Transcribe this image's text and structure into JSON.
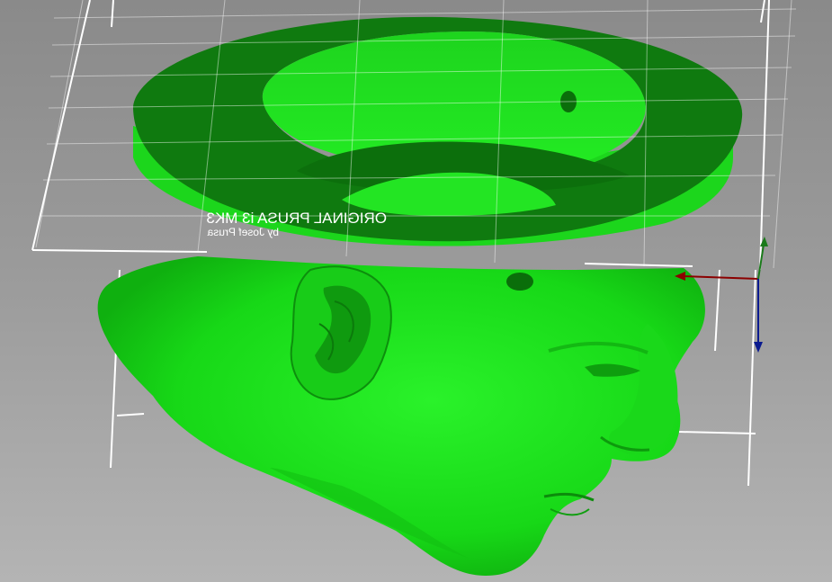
{
  "bed": {
    "brand_line": "ORIGINAL PRUSA i3 MK3",
    "author_line": "by Josef Prusa"
  },
  "model": {
    "color": "#1fe01f",
    "cut_color": "#0f7a0f"
  },
  "axes": {
    "x_color": "#8b0000",
    "y_color": "#1a7a1a",
    "z_color": "#0a1a8f"
  }
}
